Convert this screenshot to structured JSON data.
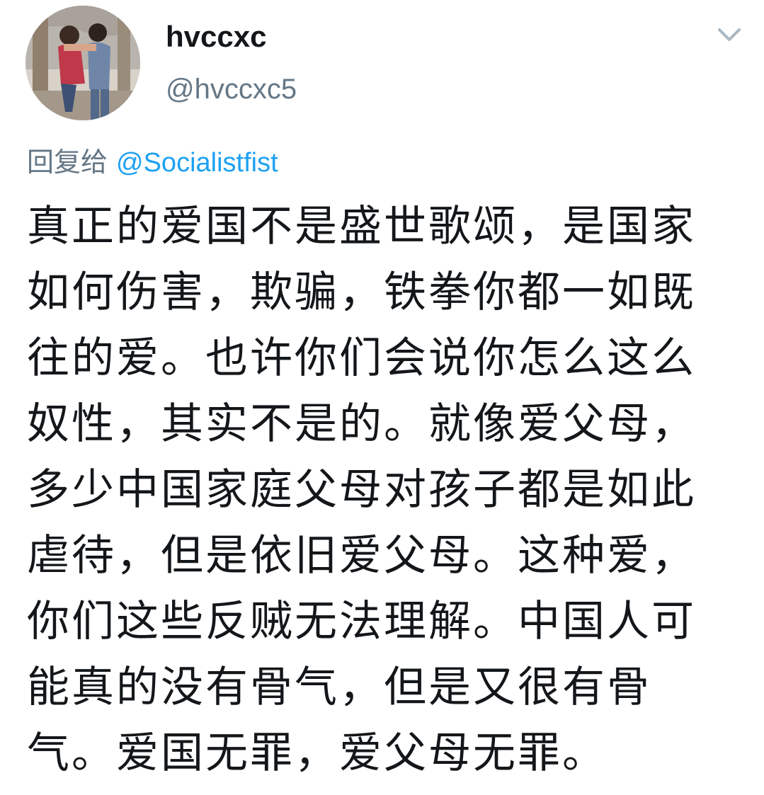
{
  "user": {
    "display_name": "hvccxc",
    "handle": "@hvccxc5"
  },
  "reply": {
    "prefix": "回复给",
    "mention": "@Socialistfist"
  },
  "tweet": {
    "lines": [
      "真正的爱国不是盛世歌颂，是国家",
      "如何伤害，欺骗，铁拳你都一如既",
      "往的爱。也许你们会说你怎么这么",
      "奴性，其实不是的。就像爱父母，",
      "多少中国家庭父母对孩子都是如此",
      "虐待，但是依旧爱父母。这种爱，",
      "你们这些反贼无法理解。中国人可",
      "能真的没有骨气，但是又很有骨",
      "气。爱国无罪，爱父母无罪。"
    ]
  },
  "icons": {
    "menu": "chevron-down-icon"
  },
  "colors": {
    "text": "#14171a",
    "secondary": "#657786",
    "link": "#1da1f2"
  }
}
